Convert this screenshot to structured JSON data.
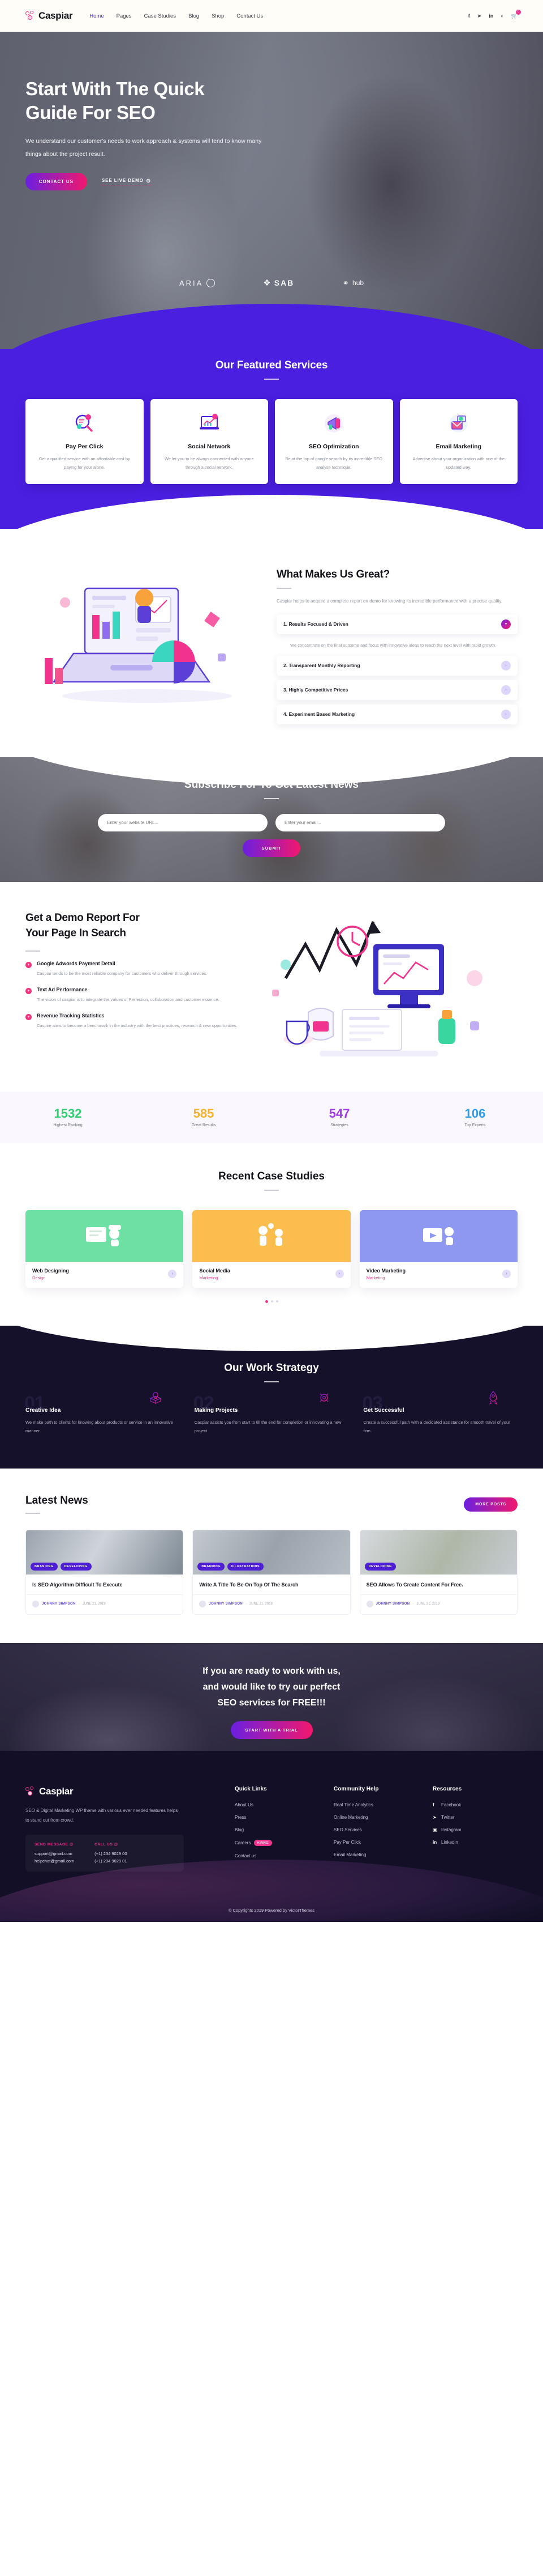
{
  "header": {
    "brand": "Caspiar",
    "nav": [
      {
        "label": "Home",
        "active": true
      },
      {
        "label": "Pages",
        "active": false
      },
      {
        "label": "Case Studies",
        "active": false
      },
      {
        "label": "Blog",
        "active": false
      },
      {
        "label": "Shop",
        "active": false
      },
      {
        "label": "Contact Us",
        "active": false
      }
    ],
    "socials": [
      "facebook-icon",
      "twitter-icon",
      "linkedin-icon",
      "rss-icon"
    ],
    "cart_count": "0"
  },
  "hero": {
    "title_line1": "Start With The Quick",
    "title_line2": "Guide For SEO",
    "paragraph": "We understand our customer's needs to work approach & systems will tend to know many things about the project result.",
    "primary_btn": "CONTACT US",
    "secondary_btn": "SEE LIVE DEMO",
    "brands": [
      "ARIA",
      "SAB",
      "hub"
    ]
  },
  "services": {
    "title": "Our Featured Services",
    "cards": [
      {
        "icon": "magnifier-chart-icon",
        "title": "Pay Per Click",
        "text": "Get a qualified service with an affordable cost by paying for your alone."
      },
      {
        "icon": "laptop-graph-icon",
        "title": "Social Network",
        "text": "We let you to be always connected with anyone through a social network."
      },
      {
        "icon": "megaphone-icon",
        "title": "SEO Optimization",
        "text": "Be at the top of google search by its incredible SEO analyse technique."
      },
      {
        "icon": "envelope-icon",
        "title": "Email Marketing",
        "text": "Advertise about your organization with one of the updated way."
      }
    ],
    "dots": 3,
    "active_dot": 1
  },
  "great": {
    "title": "What Makes Us Great?",
    "intro": "Caspiar helps to acquire a complete report on demo for knowing its incredible performance with a precise quality.",
    "items": [
      {
        "title": "1. Results Focused & Driven",
        "open": true,
        "body": "We concentrate on the final outcome and focus with innovative ideas to reach the next level with rapid growth."
      },
      {
        "title": "2. Transparent Monthly Reporting",
        "open": false,
        "body": ""
      },
      {
        "title": "3. Highly Competitive Prices",
        "open": false,
        "body": ""
      },
      {
        "title": "4. Experiment Based Marketing",
        "open": false,
        "body": ""
      }
    ]
  },
  "subscribe": {
    "title": "Subscribe For To Get Latest News",
    "url_placeholder": "Enter your website URL...",
    "email_placeholder": "Enter your email...",
    "submit_label": "SUBMIT"
  },
  "demo": {
    "title_line1": "Get a Demo Report For",
    "title_line2": "Your Page In Search",
    "features": [
      {
        "title": "Google Adwords Payment Detail",
        "text": "Caspiar tends to be the most reliable company for customers who deliver through services."
      },
      {
        "title": "Text Ad Performance",
        "text": "The vision of caspiar is to integrate the values of Perfection, collaboration and customer essence."
      },
      {
        "title": "Revenue Tracking Statistics",
        "text": "Caspire aims to become a benchmark in the industry with the best practices, research & new opportunities."
      }
    ]
  },
  "counters": [
    {
      "value": "1532",
      "label": "Highest Ranking",
      "color": "#2fcc71"
    },
    {
      "value": "585",
      "label": "Great Results",
      "color": "#f5b22d"
    },
    {
      "value": "547",
      "label": "Strategies",
      "color": "#a13ae0"
    },
    {
      "value": "106",
      "label": "Top Experts",
      "color": "#2f9ce8"
    }
  ],
  "cases": {
    "title": "Recent Case Studies",
    "items": [
      {
        "title": "Web Designing",
        "category": "Design",
        "color": "#6fe0a4"
      },
      {
        "title": "Social Media",
        "category": "Marketing",
        "color": "#fbbd4d"
      },
      {
        "title": "Video Marketing",
        "category": "Marketing",
        "color": "#8f98f0"
      }
    ],
    "dots": 3,
    "active_dot": 0
  },
  "strategy": {
    "title": "Our Work Strategy",
    "items": [
      {
        "num": "01",
        "title": "Creative Idea",
        "text": "We make path to clients for knowing about products or service in an innovative manner.",
        "icon": "lightbulb-box-icon"
      },
      {
        "num": "02",
        "title": "Making Projects",
        "text": "Caspiar assists you from start to till the end for completion or innovating a new project.",
        "icon": "gear-icon"
      },
      {
        "num": "03",
        "title": "Get Successful",
        "text": "Create a successful path with a dedicated assistance for smooth travel of your firm.",
        "icon": "rocket-icon"
      }
    ]
  },
  "news": {
    "title": "Latest News",
    "more_label": "MORE POSTS",
    "posts": [
      {
        "tags": [
          "BRANDING",
          "DEVELOPING"
        ],
        "title": "Is SEO Algorithm Difficult To Execute",
        "author": "JOHNNY SIMPSON",
        "date": "JUNE 21, 2019"
      },
      {
        "tags": [
          "BRANDING",
          "ILLUSTRATIONS"
        ],
        "title": "Write A Title To Be On Top Of The Search",
        "author": "JOHNNY SIMPSON",
        "date": "JUNE 21, 2019"
      },
      {
        "tags": [
          "DEVELOPING"
        ],
        "title": "SEO Allows To Create Content For Free.",
        "author": "JOHNNY SIMPSON",
        "date": "JUNE 21, 2019"
      }
    ]
  },
  "cta": {
    "line1": "If you are ready to work with us,",
    "line2": "and would like to try our perfect",
    "line3": "SEO services for FREE!!!",
    "btn": "START WITH A TRIAL"
  },
  "footer": {
    "brand": "Caspiar",
    "about": "SEO & Digital Marketing WP theme with various ever needed features helps to stand out from crowd.",
    "send_label": "SEND MESSAGE @",
    "call_label": "CALL US @",
    "emails": [
      "support@gmail.com",
      "helpchat@gmail.com"
    ],
    "phones": [
      "(+1) 234 9029 00",
      "(+1) 234 9029 01"
    ],
    "quick_links": {
      "title": "Quick Links",
      "items": [
        {
          "label": "About Us",
          "badge": ""
        },
        {
          "label": "Press",
          "badge": ""
        },
        {
          "label": "Blog",
          "badge": ""
        },
        {
          "label": "Careers",
          "badge": "HIRING!"
        },
        {
          "label": "Contact us",
          "badge": ""
        }
      ]
    },
    "community": {
      "title": "Community Help",
      "items": [
        "Real Time Analytics",
        "Online Marketing",
        "SEO Services",
        "Pay Per Click",
        "Email Marketing"
      ]
    },
    "resources": {
      "title": "Resources",
      "items": [
        {
          "label": "Facebook",
          "icon": "facebook-icon",
          "glyph": "f"
        },
        {
          "label": "Twitter",
          "icon": "twitter-icon",
          "glyph": "✉"
        },
        {
          "label": "Instagram",
          "icon": "instagram-icon",
          "glyph": "▣"
        },
        {
          "label": "Linkedin",
          "icon": "linkedin-icon",
          "glyph": "in"
        }
      ]
    },
    "copyright": "© Copyrights 2019 Powered by VictorThemes"
  },
  "colors": {
    "purple": "#4a1fe0",
    "pink": "#f2338d",
    "dark": "#15112b"
  }
}
